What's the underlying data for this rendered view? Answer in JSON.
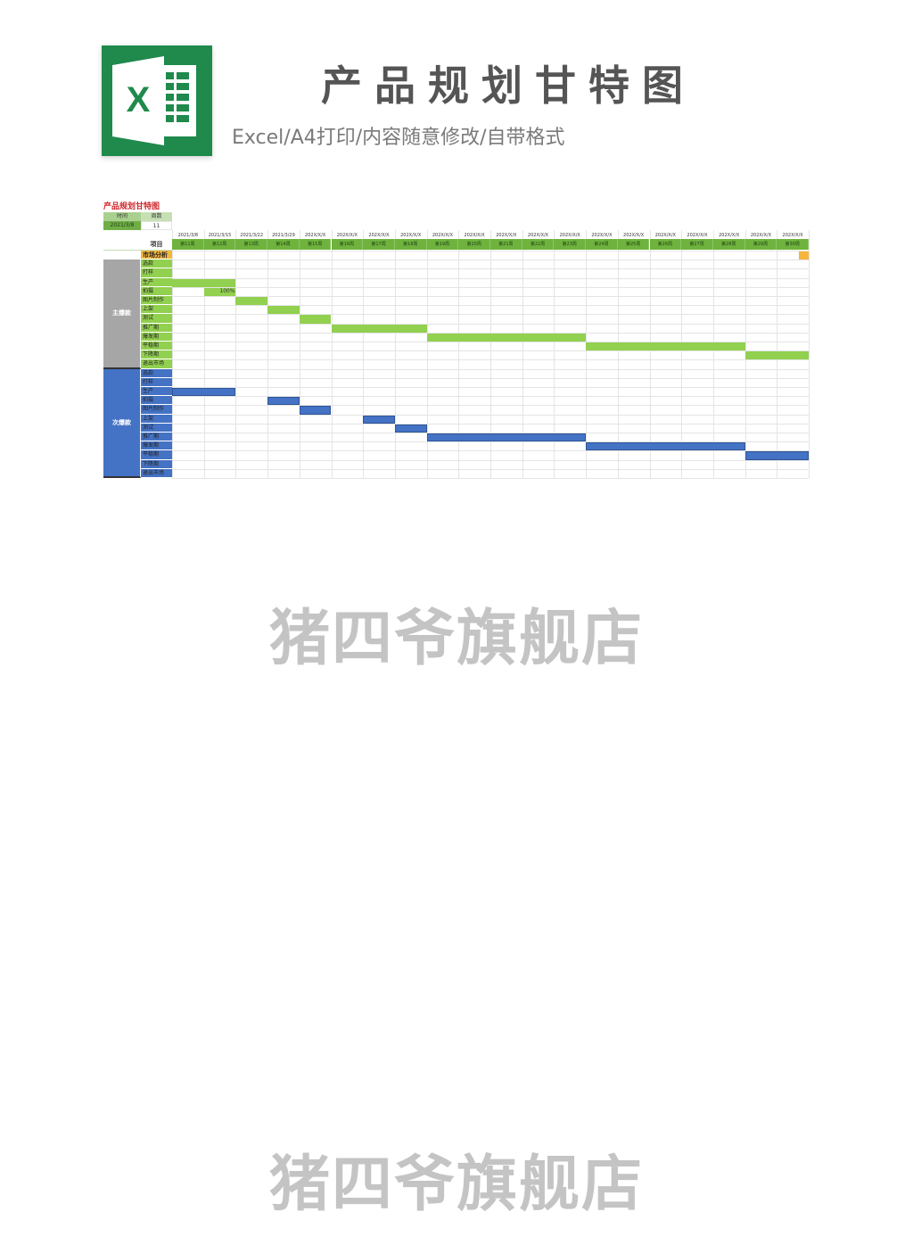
{
  "header": {
    "title": "产品规划甘特图",
    "subtitle": "Excel/A4打印/内容随意修改/自带格式",
    "logo_letter": "X"
  },
  "watermarks": [
    "猪四爷旗舰店",
    "猪四爷旗舰店"
  ],
  "sheet": {
    "title": "产品规划甘特图",
    "meta_labels": [
      "时间",
      "周数"
    ],
    "meta_values": [
      "2021/3/8",
      "11"
    ],
    "project_label": "项目",
    "dates": [
      "2021/3/8",
      "2021/3/15",
      "2021/3/22",
      "2021/3/29",
      "202X/X/X",
      "202X/X/X",
      "202X/X/X",
      "202X/X/X",
      "202X/X/X",
      "202X/X/X",
      "202X/X/X",
      "202X/X/X",
      "202X/X/X",
      "202X/X/X",
      "202X/X/X",
      "202X/X/X",
      "202X/X/X",
      "202X/X/X",
      "202X/X/X",
      "202X/X/X"
    ],
    "weeks": [
      "第11周",
      "第12周",
      "第13周",
      "第14周",
      "第15周",
      "第16周",
      "第17周",
      "第18周",
      "第19周",
      "第20周",
      "第21周",
      "第22周",
      "第23周",
      "第24周",
      "第25周",
      "第26周",
      "第27周",
      "第28周",
      "第29周",
      "第30周"
    ],
    "market_row": {
      "label": "市场分析",
      "color": "#f4b63f",
      "bar_start": 19.7,
      "bar_end": 20
    },
    "groups": [
      {
        "name": "主爆款",
        "color": "#a6a6a6",
        "task_color": "#92d050",
        "bar_color": "#92d050",
        "tasks": [
          {
            "label": "选款"
          },
          {
            "label": "打样"
          },
          {
            "label": "生产",
            "start": 0,
            "end": 2
          },
          {
            "label": "拍摄",
            "start": 1,
            "end": 2,
            "note": "100%"
          },
          {
            "label": "图片制作",
            "start": 2,
            "end": 3
          },
          {
            "label": "上架",
            "start": 3,
            "end": 4
          },
          {
            "label": "测试",
            "start": 4,
            "end": 5
          },
          {
            "label": "推广期",
            "start": 5,
            "end": 8
          },
          {
            "label": "爆发期",
            "start": 8,
            "end": 13
          },
          {
            "label": "平稳期",
            "start": 13,
            "end": 18
          },
          {
            "label": "下降期",
            "start": 18,
            "end": 20
          },
          {
            "label": "退出市场"
          }
        ]
      },
      {
        "name": "次爆款",
        "color": "#4472c4",
        "task_color": "#4472c4",
        "bar_color": "#4472c4",
        "tasks": [
          {
            "label": "选款"
          },
          {
            "label": "打样"
          },
          {
            "label": "生产",
            "start": 0,
            "end": 2
          },
          {
            "label": "拍摄",
            "start": 3,
            "end": 4
          },
          {
            "label": "图片制作",
            "start": 4,
            "end": 5
          },
          {
            "label": "上架",
            "start": 6,
            "end": 7
          },
          {
            "label": "测试",
            "start": 7,
            "end": 8
          },
          {
            "label": "推广期",
            "start": 8,
            "end": 13
          },
          {
            "label": "爆发期",
            "start": 13,
            "end": 18
          },
          {
            "label": "平稳期",
            "start": 18,
            "end": 20
          },
          {
            "label": "下降期"
          },
          {
            "label": "退出市场"
          }
        ]
      }
    ]
  }
}
